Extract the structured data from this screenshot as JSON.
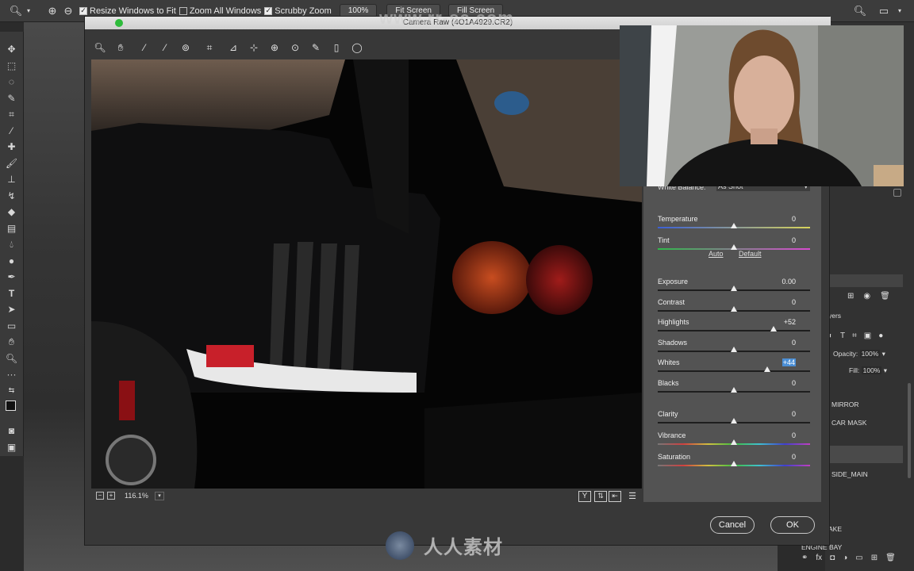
{
  "options_bar": {
    "resize_windows": "Resize Windows to Fit",
    "zoom_all": "Zoom All Windows",
    "scrubby_zoom": "Scrubby Zoom",
    "zoom_percent": "100%",
    "fit_screen": "Fit Screen",
    "fill_screen": "Fill Screen"
  },
  "dialog": {
    "title": "Camera Raw (4O1A4929.CR2)",
    "zoom_level": "116.1%",
    "cancel": "Cancel",
    "ok": "OK"
  },
  "basic": {
    "white_balance_label": "White Balance:",
    "white_balance_value": "As Shot",
    "auto": "Auto",
    "default": "Default",
    "sliders": [
      {
        "label": "Temperature",
        "value": "0",
        "pos": 0.5,
        "grad": "temp"
      },
      {
        "label": "Tint",
        "value": "0",
        "pos": 0.5,
        "grad": "tint"
      },
      {
        "label": "Exposure",
        "value": "0.00",
        "pos": 0.5,
        "grad": "none"
      },
      {
        "label": "Contrast",
        "value": "0",
        "pos": 0.5,
        "grad": "none"
      },
      {
        "label": "Highlights",
        "value": "+52",
        "pos": 0.76,
        "grad": "none"
      },
      {
        "label": "Shadows",
        "value": "0",
        "pos": 0.5,
        "grad": "none"
      },
      {
        "label": "Whites",
        "value": "+44",
        "pos": 0.72,
        "grad": "none"
      },
      {
        "label": "Blacks",
        "value": "0",
        "pos": 0.5,
        "grad": "none"
      },
      {
        "label": "Clarity",
        "value": "0",
        "pos": 0.5,
        "grad": "none"
      },
      {
        "label": "Vibrance",
        "value": "0",
        "pos": 0.5,
        "grad": "rainbow"
      },
      {
        "label": "Saturation",
        "value": "0",
        "pos": 0.5,
        "grad": "rainbow"
      }
    ]
  },
  "layers_panel": {
    "tab": "yers",
    "opacity_label": "Opacity:",
    "opacity_value": "100%",
    "fill_label": "Fill:",
    "fill_value": "100%",
    "layers": [
      "MIRROR",
      "CAR MASK",
      "SIDE_MAIN",
      "AKE",
      "ENGINE BAY"
    ]
  },
  "watermark": {
    "url": "www.rr-sc.com",
    "brand": "人人素材"
  },
  "colors": {
    "accent": "#4b8fd6",
    "panel": "#535353",
    "chrome": "#3c3c3c"
  }
}
